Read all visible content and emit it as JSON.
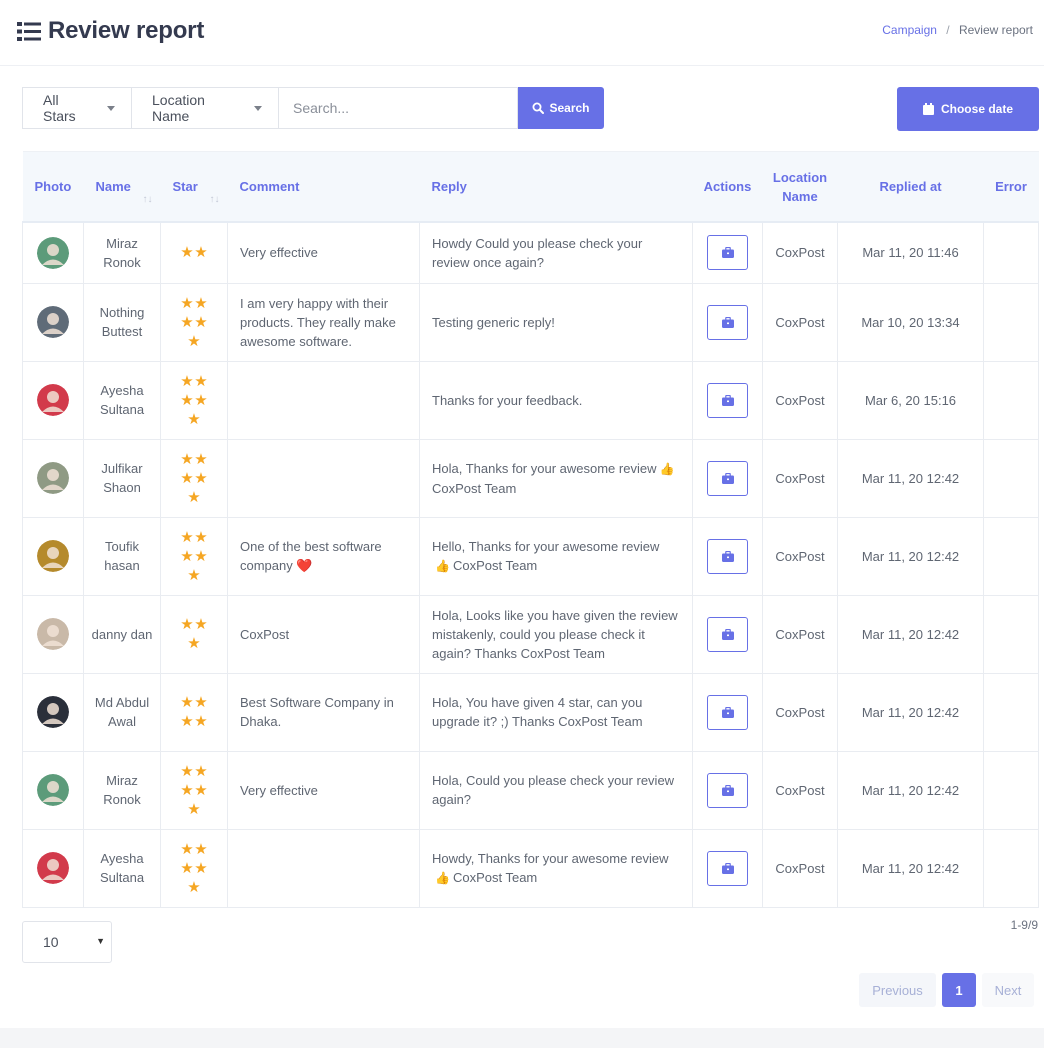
{
  "header": {
    "title": "Review report"
  },
  "breadcrumb": {
    "parent": "Campaign",
    "separator": "/",
    "current": "Review report"
  },
  "filters": {
    "stars_label": "All Stars",
    "location_label": "Location Name",
    "search_placeholder": "Search...",
    "search_button": "Search",
    "date_button": "Choose date"
  },
  "table": {
    "columns": [
      "Photo",
      "Name",
      "Star",
      "Comment",
      "Reply",
      "Actions",
      "Location Name",
      "Replied at",
      "Error"
    ],
    "rows": [
      {
        "name": "Miraz Ronok",
        "stars": 2,
        "comment": "Very effective",
        "reply": "Howdy Could you please check your review once again?",
        "reply_emoji": "",
        "reply_tail": "",
        "location": "CoxPost",
        "replied_at": "Mar 11, 20 11:46",
        "error": "",
        "avatar_color": "#5c9b7a"
      },
      {
        "name": "Nothing Buttest",
        "stars": 5,
        "comment": "I am very happy with their products. They really make awesome software.",
        "reply": "Testing generic reply!",
        "reply_emoji": "",
        "reply_tail": "",
        "location": "CoxPost",
        "replied_at": "Mar 10, 20 13:34",
        "error": "",
        "avatar_color": "#5f6b78"
      },
      {
        "name": "Ayesha Sultana",
        "stars": 5,
        "comment": "",
        "reply": "Thanks for your feedback.",
        "reply_emoji": "",
        "reply_tail": "",
        "location": "CoxPost",
        "replied_at": "Mar 6, 20 15:16",
        "error": "",
        "avatar_color": "#d23a4b"
      },
      {
        "name": "Julfikar Shaon",
        "stars": 5,
        "comment": "",
        "reply": "Hola, Thanks for your awesome review",
        "reply_emoji": "👍",
        "reply_tail": "CoxPost Team",
        "location": "CoxPost",
        "replied_at": "Mar 11, 20 12:42",
        "error": "",
        "avatar_color": "#8f9a84"
      },
      {
        "name": "Toufik hasan",
        "stars": 5,
        "comment": "One of the best software company ❤️",
        "reply": "Hello, Thanks for your awesome review",
        "reply_emoji": "👍",
        "reply_tail": "CoxPost Team",
        "location": "CoxPost",
        "replied_at": "Mar 11, 20 12:42",
        "error": "",
        "avatar_color": "#b58a2c"
      },
      {
        "name": "danny dan",
        "stars": 3,
        "comment": "CoxPost",
        "reply": "Hola, Looks like you have given the review mistakenly, could you please check it again? Thanks  CoxPost Team",
        "reply_emoji": "",
        "reply_tail": "",
        "location": "CoxPost",
        "replied_at": "Mar 11, 20 12:42",
        "error": "",
        "avatar_color": "#c9b9a8"
      },
      {
        "name": "Md Abdul Awal",
        "stars": 4,
        "comment": "Best Software Company in  Dhaka.",
        "reply": "Hola, You have given 4 star, can you upgrade it? ;) Thanks  CoxPost Team",
        "reply_emoji": "",
        "reply_tail": "",
        "location": "CoxPost",
        "replied_at": "Mar 11, 20 12:42",
        "error": "",
        "avatar_color": "#2a2f3a"
      },
      {
        "name": "Miraz Ronok",
        "stars": 5,
        "comment": "Very effective",
        "reply": "Hola, Could you please check your review again?",
        "reply_emoji": "",
        "reply_tail": "",
        "location": "CoxPost",
        "replied_at": "Mar 11, 20 12:42",
        "error": "",
        "avatar_color": "#5c9b7a"
      },
      {
        "name": "Ayesha Sultana",
        "stars": 5,
        "comment": "",
        "reply": "Howdy, Thanks for your awesome review",
        "reply_emoji": "👍",
        "reply_tail": "CoxPost Team",
        "location": "CoxPost",
        "replied_at": "Mar 11, 20 12:42",
        "error": "",
        "avatar_color": "#d23a4b"
      }
    ]
  },
  "pagination": {
    "page_size": "10",
    "range": "1-9/9",
    "previous": "Previous",
    "current_page": "1",
    "next": "Next"
  },
  "colors": {
    "accent": "#6770e6",
    "star": "#f5a623",
    "header_bg": "#f4f8fc"
  }
}
